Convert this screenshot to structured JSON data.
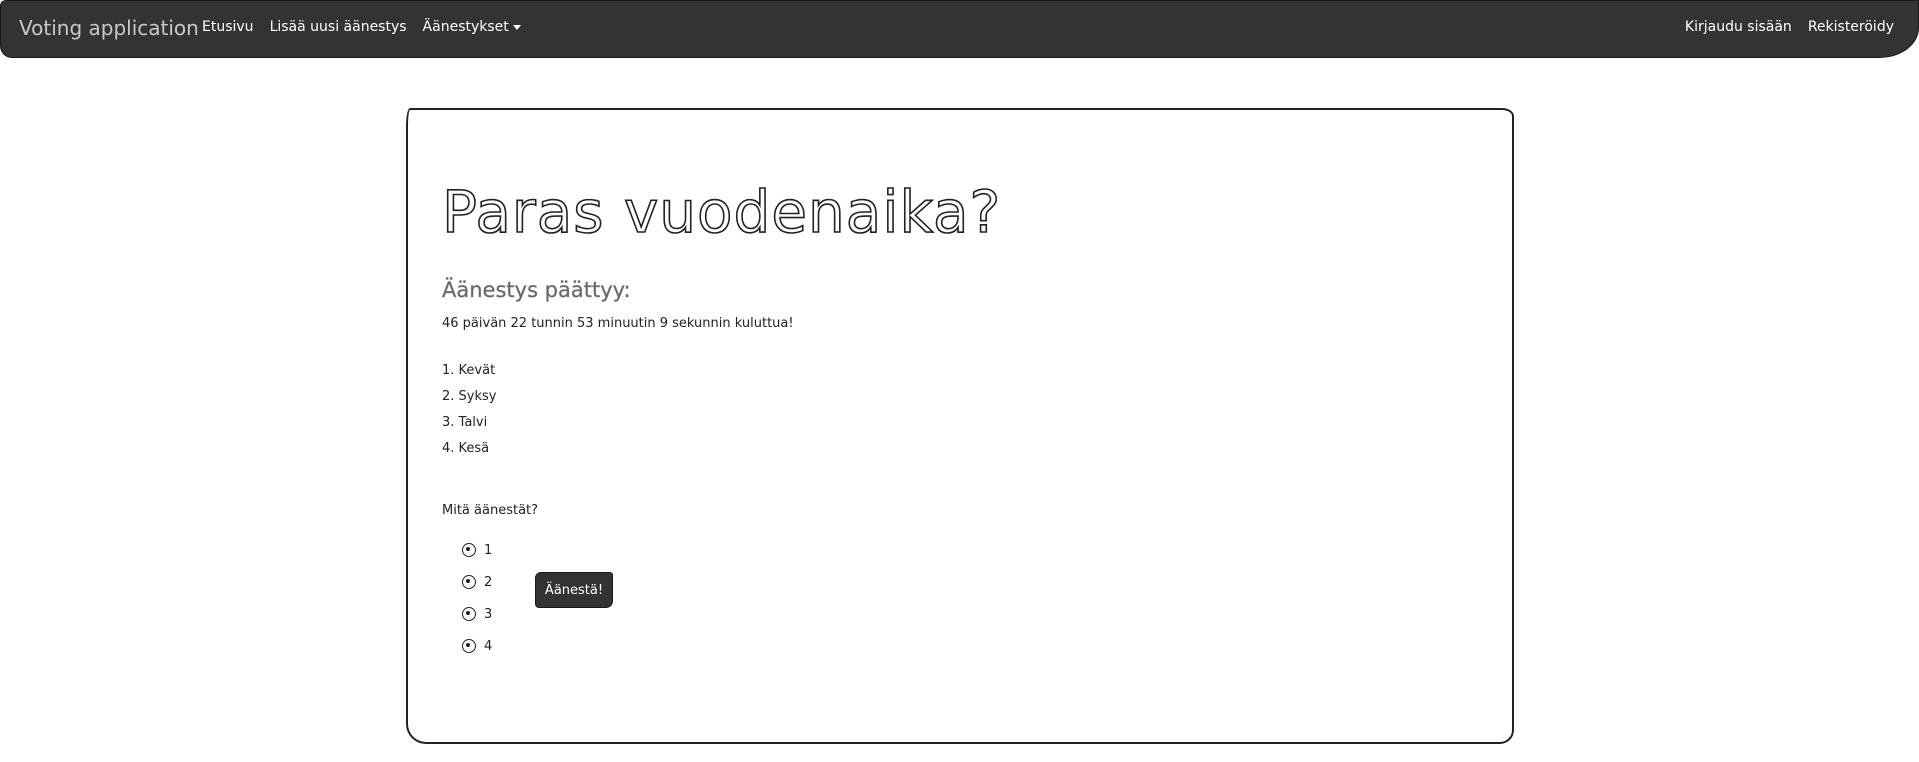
{
  "navbar": {
    "brand": "Voting application",
    "links": [
      "Etusivu",
      "Lisää uusi äänestys",
      "Äänestykset"
    ],
    "right_links": [
      "Kirjaudu sisään",
      "Rekisteröidy"
    ]
  },
  "poll": {
    "title": "Paras vuodenaika?",
    "ends_label": "Äänestys päättyy:",
    "countdown": "46 päivän 22 tunnin 53 minuutin 9 sekunnin kuluttua!",
    "options": [
      "1. Kevät",
      "2. Syksy",
      "3. Talvi",
      "4. Kesä"
    ],
    "question": "Mitä äänestät?",
    "radio_labels": [
      "1",
      "2",
      "3",
      "4"
    ],
    "vote_button": "Äänestä!"
  }
}
